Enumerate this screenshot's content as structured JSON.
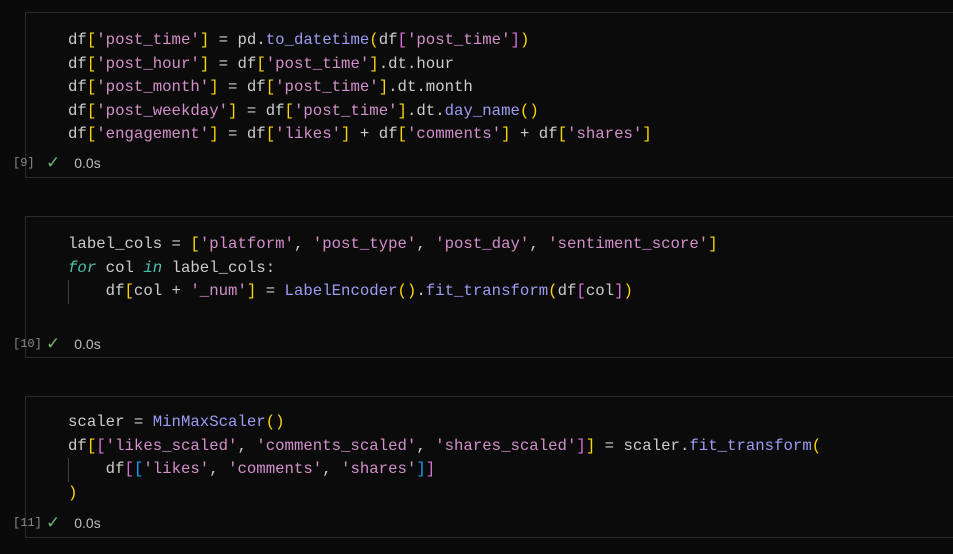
{
  "cells": [
    {
      "exec_count": "[9]",
      "status_icon": "check-icon",
      "duration": "0.0s",
      "lines": [
        {
          "indent": false,
          "tokens": [
            [
              "tx",
              "df"
            ],
            [
              "b1",
              "["
            ],
            [
              "str",
              "'post_time'"
            ],
            [
              "b1",
              "]"
            ],
            [
              "tx",
              " = pd."
            ],
            [
              "fn",
              "to_datetime"
            ],
            [
              "b1",
              "("
            ],
            [
              "tx",
              "df"
            ],
            [
              "b2",
              "["
            ],
            [
              "str",
              "'post_time'"
            ],
            [
              "b2",
              "]"
            ],
            [
              "b1",
              ")"
            ]
          ]
        },
        {
          "indent": false,
          "tokens": [
            [
              "tx",
              "df"
            ],
            [
              "b1",
              "["
            ],
            [
              "str",
              "'post_hour'"
            ],
            [
              "b1",
              "]"
            ],
            [
              "tx",
              " = df"
            ],
            [
              "b1",
              "["
            ],
            [
              "str",
              "'post_time'"
            ],
            [
              "b1",
              "]"
            ],
            [
              "tx",
              ".dt.hour"
            ]
          ]
        },
        {
          "indent": false,
          "tokens": [
            [
              "tx",
              "df"
            ],
            [
              "b1",
              "["
            ],
            [
              "str",
              "'post_month'"
            ],
            [
              "b1",
              "]"
            ],
            [
              "tx",
              " = df"
            ],
            [
              "b1",
              "["
            ],
            [
              "str",
              "'post_time'"
            ],
            [
              "b1",
              "]"
            ],
            [
              "tx",
              ".dt.month"
            ]
          ]
        },
        {
          "indent": false,
          "tokens": [
            [
              "tx",
              "df"
            ],
            [
              "b1",
              "["
            ],
            [
              "str",
              "'post_weekday'"
            ],
            [
              "b1",
              "]"
            ],
            [
              "tx",
              " = df"
            ],
            [
              "b1",
              "["
            ],
            [
              "str",
              "'post_time'"
            ],
            [
              "b1",
              "]"
            ],
            [
              "tx",
              ".dt."
            ],
            [
              "fn",
              "day_name"
            ],
            [
              "b1",
              "()"
            ]
          ]
        },
        {
          "indent": false,
          "tokens": [
            [
              "tx",
              "df"
            ],
            [
              "b1",
              "["
            ],
            [
              "str",
              "'engagement'"
            ],
            [
              "b1",
              "]"
            ],
            [
              "tx",
              " = df"
            ],
            [
              "b1",
              "["
            ],
            [
              "str",
              "'likes'"
            ],
            [
              "b1",
              "]"
            ],
            [
              "tx",
              " + df"
            ],
            [
              "b1",
              "["
            ],
            [
              "str",
              "'comments'"
            ],
            [
              "b1",
              "]"
            ],
            [
              "tx",
              " + df"
            ],
            [
              "b1",
              "["
            ],
            [
              "str",
              "'shares'"
            ],
            [
              "b1",
              "]"
            ]
          ]
        }
      ]
    },
    {
      "exec_count": "[10]",
      "status_icon": "check-icon",
      "duration": "0.0s",
      "lines": [
        {
          "indent": false,
          "tokens": [
            [
              "tx",
              "label_cols = "
            ],
            [
              "b1",
              "["
            ],
            [
              "str",
              "'platform'"
            ],
            [
              "tx",
              ", "
            ],
            [
              "str",
              "'post_type'"
            ],
            [
              "tx",
              ", "
            ],
            [
              "str",
              "'post_day'"
            ],
            [
              "tx",
              ", "
            ],
            [
              "str",
              "'sentiment_score'"
            ],
            [
              "b1",
              "]"
            ]
          ]
        },
        {
          "indent": false,
          "tokens": [
            [
              "kw",
              "for"
            ],
            [
              "tx",
              " col "
            ],
            [
              "kw",
              "in"
            ],
            [
              "tx",
              " label_cols:"
            ]
          ]
        },
        {
          "indent": true,
          "tokens": [
            [
              "tx",
              "    df"
            ],
            [
              "b1",
              "["
            ],
            [
              "tx",
              "col + "
            ],
            [
              "str",
              "'_num'"
            ],
            [
              "b1",
              "]"
            ],
            [
              "tx",
              " = "
            ],
            [
              "fn",
              "LabelEncoder"
            ],
            [
              "b1",
              "()"
            ],
            [
              "tx",
              "."
            ],
            [
              "fn",
              "fit_transform"
            ],
            [
              "b1",
              "("
            ],
            [
              "tx",
              "df"
            ],
            [
              "b2",
              "["
            ],
            [
              "tx",
              "col"
            ],
            [
              "b2",
              "]"
            ],
            [
              "b1",
              ")"
            ]
          ]
        }
      ]
    },
    {
      "exec_count": "[11]",
      "status_icon": "check-icon",
      "duration": "0.0s",
      "lines": [
        {
          "indent": false,
          "tokens": [
            [
              "tx",
              "scaler = "
            ],
            [
              "fn",
              "MinMaxScaler"
            ],
            [
              "b1",
              "()"
            ]
          ]
        },
        {
          "indent": false,
          "tokens": [
            [
              "tx",
              "df"
            ],
            [
              "b1",
              "["
            ],
            [
              "b2",
              "["
            ],
            [
              "str",
              "'likes_scaled'"
            ],
            [
              "tx",
              ", "
            ],
            [
              "str",
              "'comments_scaled'"
            ],
            [
              "tx",
              ", "
            ],
            [
              "str",
              "'shares_scaled'"
            ],
            [
              "b2",
              "]"
            ],
            [
              "b1",
              "]"
            ],
            [
              "tx",
              " = scaler."
            ],
            [
              "fn",
              "fit_transform"
            ],
            [
              "b1",
              "("
            ]
          ]
        },
        {
          "indent": true,
          "tokens": [
            [
              "tx",
              "    df"
            ],
            [
              "b2",
              "["
            ],
            [
              "b3",
              "["
            ],
            [
              "str",
              "'likes'"
            ],
            [
              "tx",
              ", "
            ],
            [
              "str",
              "'comments'"
            ],
            [
              "tx",
              ", "
            ],
            [
              "str",
              "'shares'"
            ],
            [
              "b3",
              "]"
            ],
            [
              "b2",
              "]"
            ]
          ]
        },
        {
          "indent": false,
          "tokens": [
            [
              "b1",
              ")"
            ]
          ]
        }
      ]
    }
  ]
}
